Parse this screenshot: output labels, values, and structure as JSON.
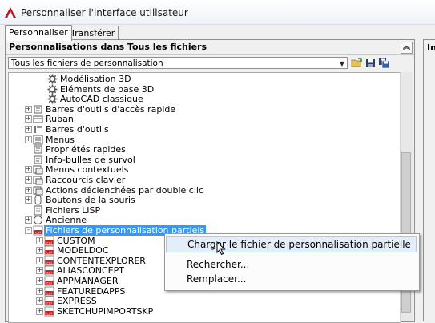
{
  "window": {
    "title": "Personnaliser l'interface utilisateur"
  },
  "tabs": [
    {
      "label": "Personnaliser",
      "active": true
    },
    {
      "label": "Transférer",
      "active": false
    }
  ],
  "left_panel": {
    "header": "Personnalisations dans Tous les fichiers",
    "dropdown_value": "Tous les fichiers de personnalisation"
  },
  "right_panel": {
    "header": "In"
  },
  "tree": [
    {
      "label": "Modélisation 3D",
      "icon": "gear-icon"
    },
    {
      "label": "Eléments de base 3D",
      "icon": "gear-icon"
    },
    {
      "label": "AutoCAD classique",
      "icon": "gear-icon"
    },
    {
      "label": "Barres d'outils d'accès rapide",
      "icon": "quick-access-toolbar-icon"
    },
    {
      "label": "Ruban",
      "icon": "ribbon-icon"
    },
    {
      "label": "Barres d'outils",
      "icon": "toolbar-icon"
    },
    {
      "label": "Menus",
      "icon": "menu-icon"
    },
    {
      "label": "Propriétés rapides",
      "icon": "quick-properties-icon"
    },
    {
      "label": "Info-bulles de survol",
      "icon": "tooltip-icon"
    },
    {
      "label": "Menus contextuels",
      "icon": "context-menu-icon"
    },
    {
      "label": "Raccourcis clavier",
      "icon": "keyboard-shortcut-icon"
    },
    {
      "label": "Actions déclenchées par double clic",
      "icon": "double-click-icon"
    },
    {
      "label": "Boutons de la souris",
      "icon": "mouse-icon"
    },
    {
      "label": "Fichiers LISP",
      "icon": "lisp-file-icon"
    },
    {
      "label": "Ancienne",
      "icon": "legacy-icon"
    },
    {
      "label": "Fichiers de personnalisation partiels",
      "icon": "cui-folder-icon"
    },
    {
      "label": "CUSTOM",
      "icon": "cuix-file-icon"
    },
    {
      "label": "MODELDOC",
      "icon": "cuix-file-icon"
    },
    {
      "label": "CONTENTEXPLORER",
      "icon": "cuix-file-icon"
    },
    {
      "label": "ALIASCONCEPT",
      "icon": "cuix-file-icon"
    },
    {
      "label": "APPMANAGER",
      "icon": "cuix-file-icon"
    },
    {
      "label": "FEATUREDAPPS",
      "icon": "cuix-file-icon"
    },
    {
      "label": "EXPRESS",
      "icon": "cuix-file-icon"
    },
    {
      "label": "SKETCHUPIMPORTSKP",
      "icon": "cuix-file-icon"
    }
  ],
  "context_menu": [
    {
      "label": "Charger le fichier de personnalisation partielle"
    },
    {
      "label": "Rechercher..."
    },
    {
      "label": "Remplacer..."
    }
  ],
  "colors": {
    "selection": "#3399ff",
    "app_icon": "#c1121f",
    "cuix_icon": "#d42020"
  }
}
